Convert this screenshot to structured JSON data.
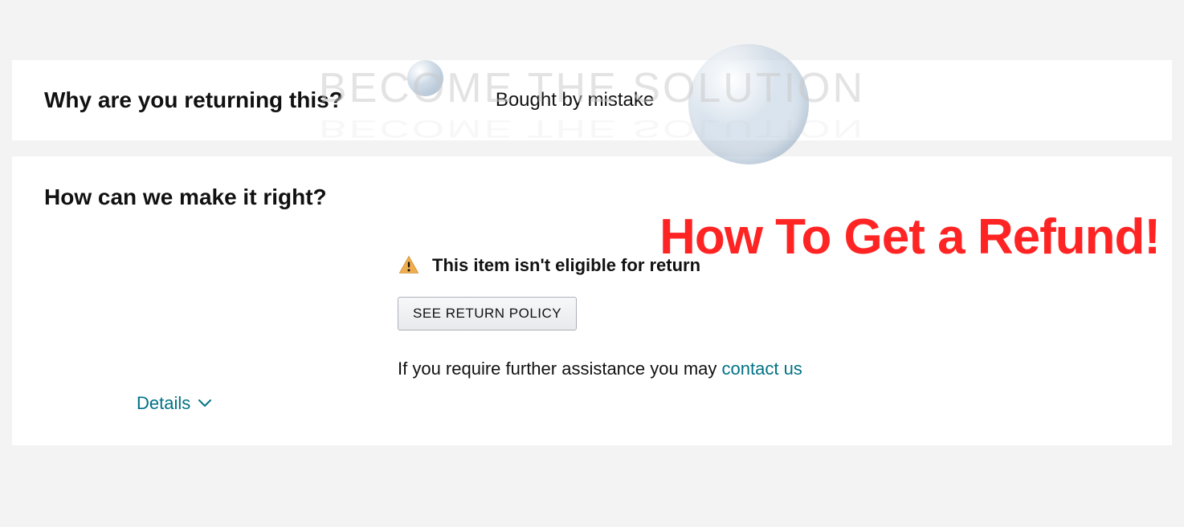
{
  "watermark": {
    "text": "BECOME THE SOLUTION"
  },
  "overlay": {
    "title": "How To Get a Refund!"
  },
  "section1": {
    "heading": "Why are you returning this?",
    "reason": "Bought by mistake"
  },
  "section2": {
    "heading": "How can we make it right?",
    "warning_message": "This item isn't eligible for return",
    "policy_button_label": "SEE RETURN POLICY",
    "assistance_prefix": "If you require further assistance you may ",
    "contact_link_text": "contact us",
    "details_label": "Details"
  }
}
